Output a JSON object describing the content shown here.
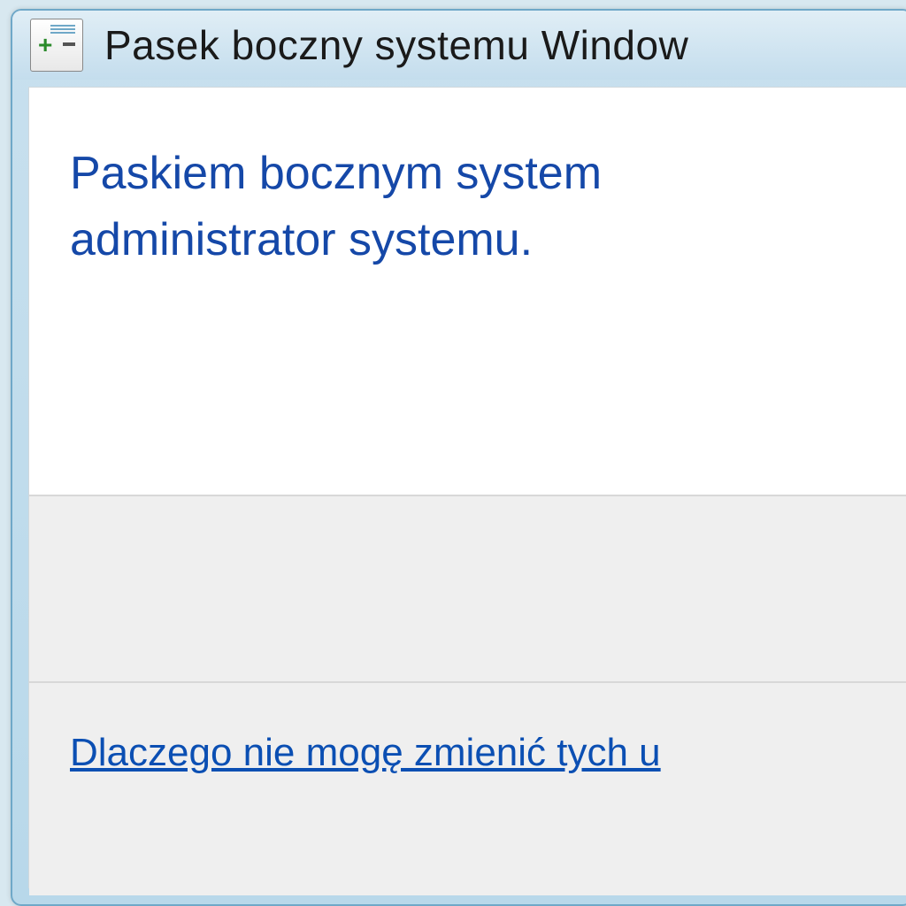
{
  "window": {
    "title": "Pasek boczny systemu Window"
  },
  "message": {
    "line1": "Paskiem bocznym system",
    "line2": "administrator systemu."
  },
  "link": {
    "help_text": "Dlaczego nie mogę zmienić tych u"
  }
}
